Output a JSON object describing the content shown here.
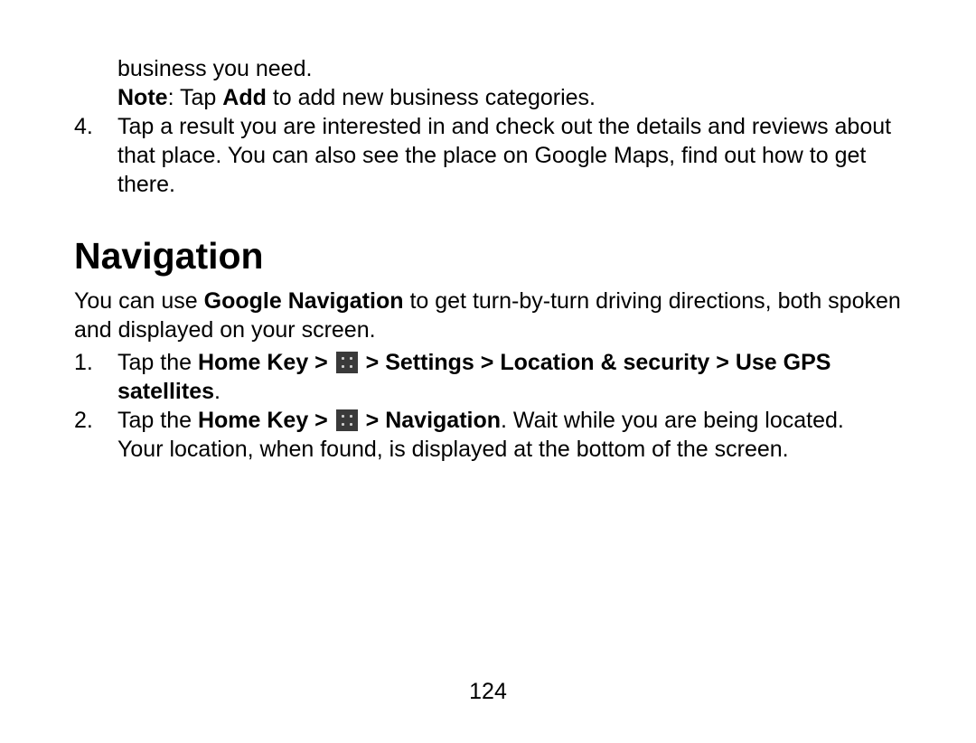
{
  "top": {
    "frag_line": "business you need.",
    "note_label": "Note",
    "note_sep": ": Tap ",
    "note_bold2": "Add",
    "note_tail": " to add new business categories.",
    "item4_num": "4.",
    "item4_text": "Tap a result you are interested in and check out the details and reviews about that place. You can also see the place on Google Maps, find out how to get there."
  },
  "nav": {
    "heading": "Navigation",
    "intro_pre": "You can use ",
    "intro_bold": "Google Navigation",
    "intro_post": " to get turn-by-turn driving directions, both spoken and displayed on your screen.",
    "step1_num": "1.",
    "step1_pre": "Tap the ",
    "step1_bold1": "Home Key > ",
    "step1_bold2": " > Settings > Location & security > Use GPS satellites",
    "step1_tail": ".",
    "step2_num": "2.",
    "step2_pre": "Tap the ",
    "step2_bold1": "Home Key > ",
    "step2_bold2": " > Navigation",
    "step2_mid": ". Wait while you are being located.",
    "step2_line2": "Your location, when found, is displayed at the bottom of the screen."
  },
  "page_number": "124"
}
